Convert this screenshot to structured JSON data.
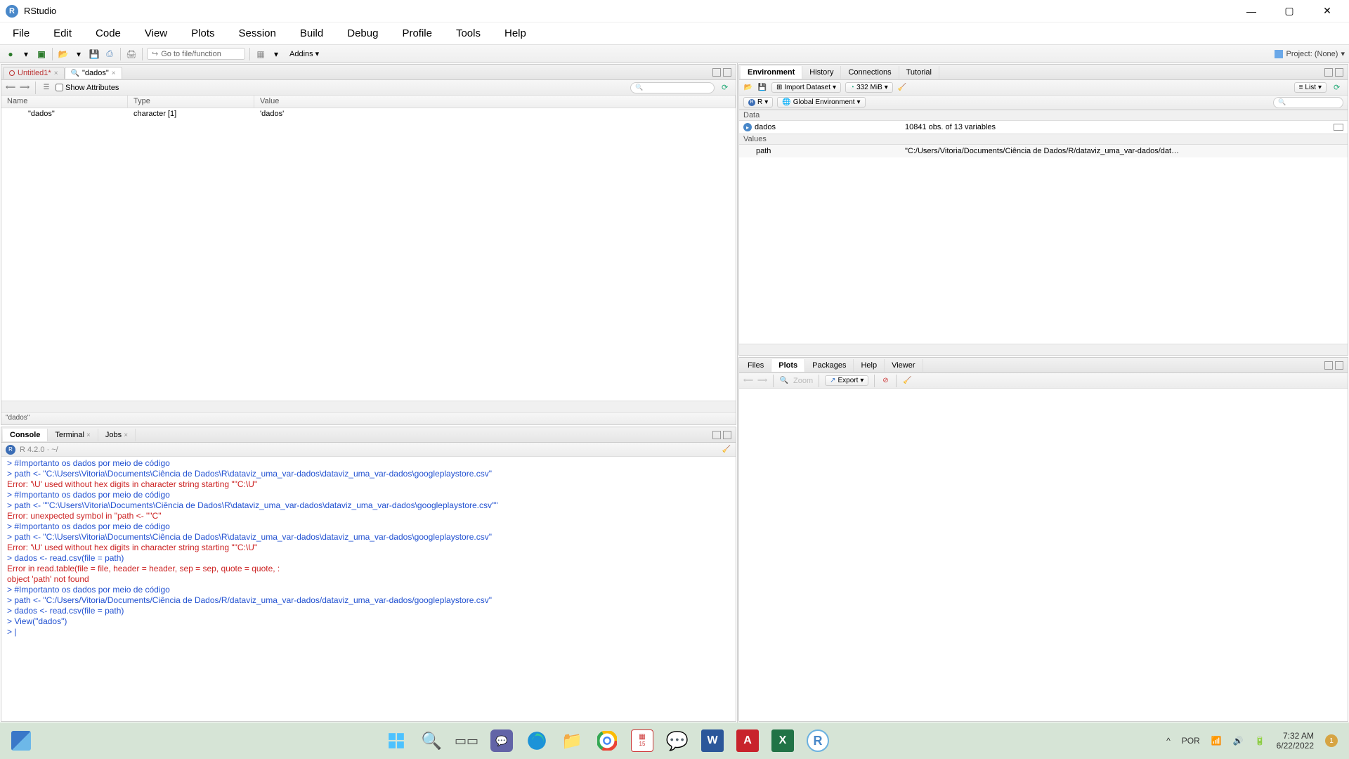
{
  "titlebar": {
    "app_name": "RStudio"
  },
  "menubar": [
    "File",
    "Edit",
    "Code",
    "View",
    "Plots",
    "Session",
    "Build",
    "Debug",
    "Profile",
    "Tools",
    "Help"
  ],
  "toolbar": {
    "gotofile_placeholder": "Go to file/function",
    "addins_label": "Addins",
    "project_label": "Project: (None)"
  },
  "source": {
    "tabs": [
      {
        "label": "Untitled1*",
        "active": false
      },
      {
        "label": "\"dados\"",
        "active": true
      }
    ],
    "show_attributes_label": "Show Attributes",
    "columns": {
      "name": "Name",
      "type": "Type",
      "value": "Value"
    },
    "row": {
      "name": "\"dados\"",
      "type": "character [1]",
      "value": "'dados'"
    },
    "status": "\"dados\""
  },
  "console": {
    "tabs": [
      "Console",
      "Terminal",
      "Jobs"
    ],
    "header_ver": "R 4.2.0 · ~/",
    "lines": [
      {
        "class": "c-blue",
        "text": "> #Importanto os dados por meio de código"
      },
      {
        "class": "c-blue",
        "text": "> path <- \"C:\\Users\\Vitoria\\Documents\\Ciência de Dados\\R\\dataviz_uma_var-dados\\dataviz_uma_var-dados\\googleplaystore.csv\""
      },
      {
        "class": "c-red",
        "text": "Error: '\\U' used without hex digits in character string starting \"\"C:\\U\""
      },
      {
        "class": "c-blue",
        "text": "> #Importanto os dados por meio de código"
      },
      {
        "class": "c-blue",
        "text": "> path <- \"\"C:\\Users\\Vitoria\\Documents\\Ciência de Dados\\R\\dataviz_uma_var-dados\\dataviz_uma_var-dados\\googleplaystore.csv\"\""
      },
      {
        "class": "c-red",
        "text": "Error: unexpected symbol in \"path <- \"\"C\""
      },
      {
        "class": "c-blue",
        "text": "> #Importanto os dados por meio de código"
      },
      {
        "class": "c-blue",
        "text": "> path <- \"C:\\Users\\Vitoria\\Documents\\Ciência de Dados\\R\\dataviz_uma_var-dados\\dataviz_uma_var-dados\\googleplaystore.csv\""
      },
      {
        "class": "c-red",
        "text": "Error: '\\U' used without hex digits in character string starting \"\"C:\\U\""
      },
      {
        "class": "c-blue",
        "text": "> dados <- read.csv(file = path)"
      },
      {
        "class": "c-red",
        "text": "Error in read.table(file = file, header = header, sep = sep, quote = quote,  :"
      },
      {
        "class": "c-red",
        "text": "  object 'path' not found"
      },
      {
        "class": "c-blue",
        "text": "> #Importanto os dados por meio de código"
      },
      {
        "class": "c-blue",
        "text": "> path <- \"C:/Users/Vitoria/Documents/Ciência de Dados/R/dataviz_uma_var-dados/dataviz_uma_var-dados/googleplaystore.csv\""
      },
      {
        "class": "c-blue",
        "text": "> dados <- read.csv(file = path)"
      },
      {
        "class": "c-blue",
        "text": "> View(\"dados\")"
      },
      {
        "class": "c-blue",
        "text": "> |"
      }
    ]
  },
  "environment": {
    "tabs": [
      "Environment",
      "History",
      "Connections",
      "Tutorial"
    ],
    "import_label": "Import Dataset",
    "mem_label": "332 MiB",
    "list_label": "List",
    "r_label": "R",
    "global_env_label": "Global Environment",
    "sections": {
      "data_label": "Data",
      "values_label": "Values"
    },
    "data_rows": [
      {
        "name": "dados",
        "val": "10841 obs. of 13 variables"
      }
    ],
    "value_rows": [
      {
        "name": "path",
        "val": "\"C:/Users/Vitoria/Documents/Ciência de Dados/R/dataviz_uma_var-dados/dat…"
      }
    ]
  },
  "plots": {
    "tabs": [
      "Files",
      "Plots",
      "Packages",
      "Help",
      "Viewer"
    ],
    "zoom_label": "Zoom",
    "export_label": "Export"
  },
  "taskbar": {
    "lang": "POR",
    "time": "7:32 AM",
    "date": "6/22/2022"
  }
}
